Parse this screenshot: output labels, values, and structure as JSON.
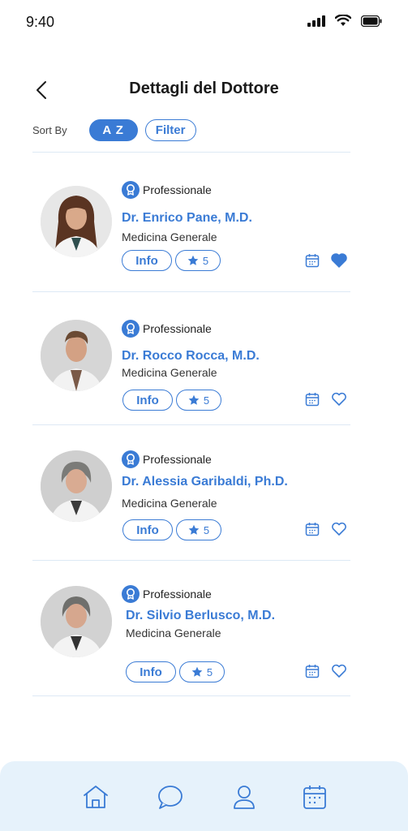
{
  "status_bar": {
    "time": "9:40"
  },
  "header": {
    "title": "Dettagli del Dottore"
  },
  "sort": {
    "label": "Sort By",
    "az_label": "A Z",
    "filter_label": "Filter"
  },
  "colors": {
    "accent": "#3a7bd5",
    "nav_bg": "#e6f2fb",
    "divider": "#dde9f5"
  },
  "doctors": [
    {
      "badge": "Professionale",
      "name": "Dr. Enrico Pane, M.D.",
      "specialty": "Medicina Generale",
      "info_label": "Info",
      "rating": "5",
      "favorite": true
    },
    {
      "badge": "Professionale",
      "name": "Dr. Rocco Rocca, M.D.",
      "specialty": "Medicina Generale",
      "info_label": "Info",
      "rating": "5",
      "favorite": false
    },
    {
      "badge": "Professionale",
      "name": "Dr. Alessia Garibaldi, Ph.D.",
      "specialty": "Medicina Generale",
      "info_label": "Info",
      "rating": "5",
      "favorite": false
    },
    {
      "badge": "Professionale",
      "name": "Dr. Silvio Berlusco, M.D.",
      "specialty": "Medicina Generale",
      "info_label": "Info",
      "rating": "5",
      "favorite": false
    }
  ],
  "bottom_nav": [
    "home-icon",
    "chat-icon",
    "profile-icon",
    "calendar-icon"
  ]
}
